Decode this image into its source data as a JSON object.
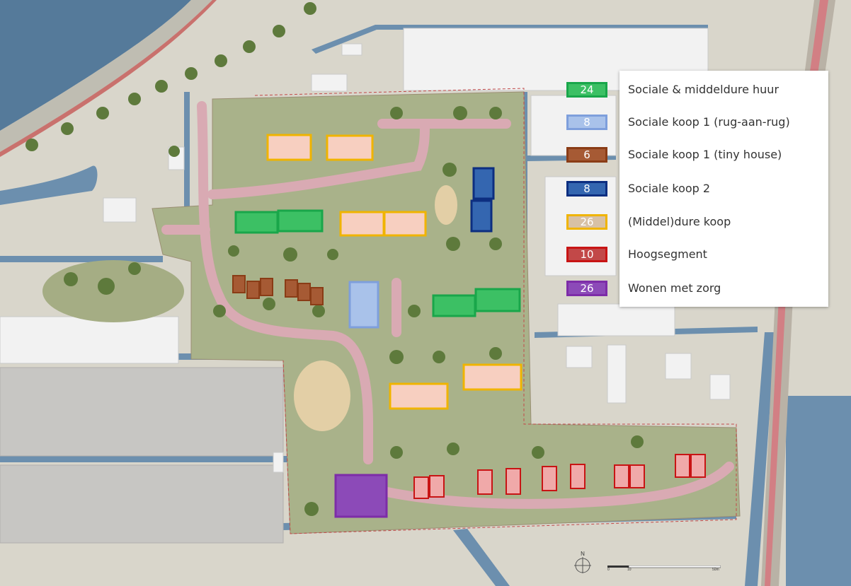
{
  "legend": {
    "items": [
      {
        "count": "24",
        "label": "Sociale & middeldure huur",
        "color": "#19a64a",
        "fill": "#3cc064"
      },
      {
        "count": "8",
        "label": "Sociale koop 1  (rug-aan-rug)",
        "color": "#7e9fdc",
        "fill": "#a9c2ea"
      },
      {
        "count": "6",
        "label": "Sociale koop 1  (tiny house)",
        "color": "#8a3c16",
        "fill": "#a65a34"
      },
      {
        "count": "8",
        "label": "Sociale koop 2",
        "color": "#0d2e80",
        "fill": "#3466b0"
      },
      {
        "count": "26",
        "label": "(Middel)dure koop",
        "color": "#f0b400",
        "fill": "#d8c1a6"
      },
      {
        "count": "10",
        "label": "Hoogsegment",
        "color": "#c81414",
        "fill": "#c24848"
      },
      {
        "count": "26",
        "label": "Wonen met zorg",
        "color": "#7d2ca8",
        "fill": "#8c4ab8"
      }
    ]
  },
  "north_arrow": {
    "label": "N",
    "icon": "north-arrow-icon"
  },
  "scale_bar": {
    "labels": [
      "0",
      "10",
      "50m"
    ]
  },
  "colors": {
    "water": "#557a9a",
    "land": "#d9d6cb",
    "green": "#a9b28a",
    "path": "#d4a9b0",
    "road": "#b8b1a4"
  }
}
